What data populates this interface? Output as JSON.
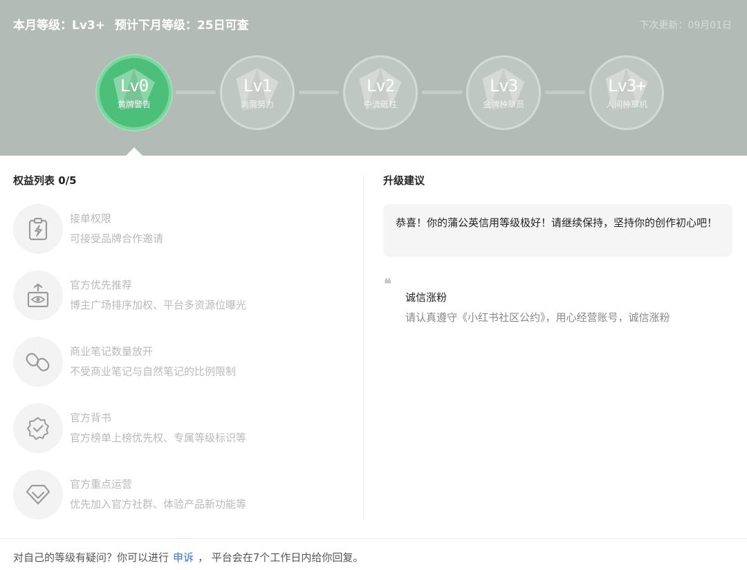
{
  "header": {
    "current_level_text": "本月等级：Lv3+",
    "next_level_text": "预计下月等级：25日可查",
    "update_text": "下次更新：09月01日",
    "levels": [
      {
        "name": "Lv0",
        "subtitle": "黄牌警告",
        "active": true
      },
      {
        "name": "Lv1",
        "subtitle": "尚需努力",
        "active": false
      },
      {
        "name": "Lv2",
        "subtitle": "中流砥柱",
        "active": false
      },
      {
        "name": "Lv3",
        "subtitle": "金牌种草员",
        "active": false
      },
      {
        "name": "Lv3+",
        "subtitle": "人间种草机",
        "active": false
      }
    ]
  },
  "benefits": {
    "title": "权益列表 0/5",
    "items": [
      {
        "title": "接单权限",
        "desc": "可接受品牌合作邀请",
        "icon": "clipboard-bolt-icon"
      },
      {
        "title": "官方优先推荐",
        "desc": "博主广场排序加权、平台多资源位曝光",
        "icon": "eye-upload-icon"
      },
      {
        "title": "商业笔记数量放开",
        "desc": "不受商业笔记与自然笔记的比例限制",
        "icon": "link-icon"
      },
      {
        "title": "官方背书",
        "desc": "官方榜单上榜优先权、专属等级标识等",
        "icon": "verified-badge-icon"
      },
      {
        "title": "官方重点运营",
        "desc": "优先加入官方社群、体验产品新功能等",
        "icon": "diamond-icon"
      }
    ]
  },
  "advice": {
    "title": "升级建议",
    "message": "恭喜！你的蒲公英信用等级极好！请继续保持，坚持你的创作初心吧！",
    "quote_mark": "❝",
    "quote_title": "诚信涨粉",
    "quote_desc": "请认真遵守《小红书社区公约》，用心经营账号，诚信涨粉"
  },
  "footer": {
    "text_before": "对自己的等级有疑问？你可以进行",
    "link": "申诉",
    "text_after": "，  平台会在7个工作日内给你回复。"
  },
  "colors": {
    "header_bg": "#b2bbb6",
    "active_level": "#4cc07a",
    "link": "#3b6fd6"
  }
}
